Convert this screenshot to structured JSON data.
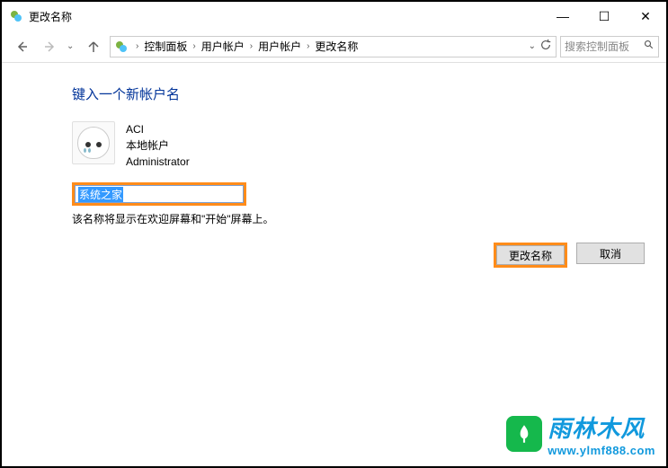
{
  "window": {
    "title": "更改名称",
    "minimize": "—",
    "maximize": "☐",
    "close": "✕"
  },
  "nav": {
    "back": "←",
    "forward": "→",
    "up": "↑"
  },
  "breadcrumb": {
    "items": [
      "控制面板",
      "用户帐户",
      "用户帐户",
      "更改名称"
    ]
  },
  "search": {
    "placeholder": "搜索控制面板"
  },
  "page": {
    "title": "键入一个新帐户名"
  },
  "account": {
    "name": "ACI",
    "type": "本地帐户",
    "role": "Administrator"
  },
  "input": {
    "value": "系统之家"
  },
  "hint": "该名称将显示在欢迎屏幕和\"开始\"屏幕上。",
  "buttons": {
    "submit": "更改名称",
    "cancel": "取消"
  },
  "watermark": {
    "title": "雨林木风",
    "url": "www.ylmf888.com"
  }
}
